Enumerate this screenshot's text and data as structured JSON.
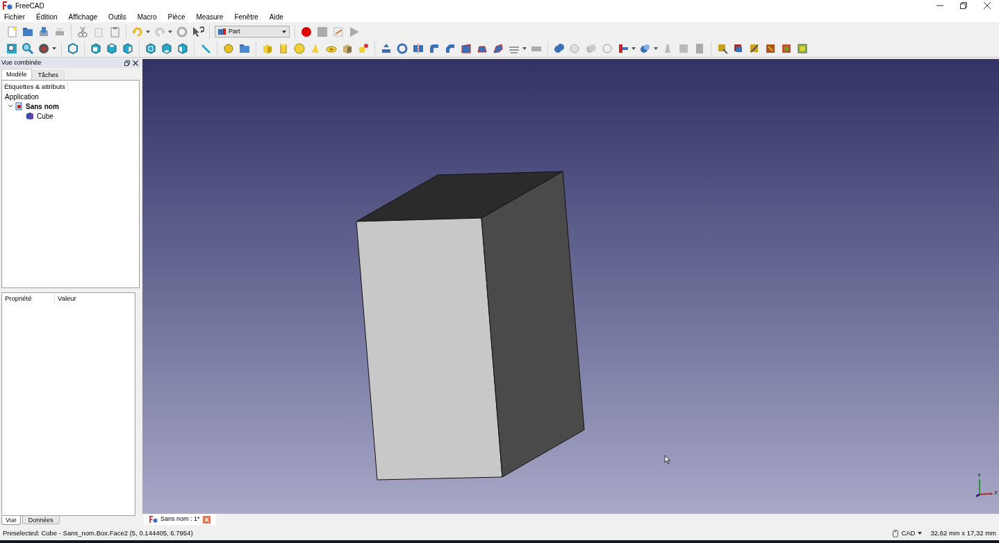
{
  "window": {
    "title": "FreeCAD"
  },
  "menu": [
    "Fichier",
    "Édition",
    "Affichage",
    "Outils",
    "Macro",
    "Pièce",
    "Measure",
    "Fenêtre",
    "Aide"
  ],
  "workbench": {
    "value": "Part"
  },
  "combo_view": {
    "title": "Vue combinée",
    "tabs": [
      {
        "label": "Modèle",
        "selected": true
      },
      {
        "label": "Tâches",
        "selected": false
      }
    ],
    "tree_header": "Étiquettes & attributs",
    "tree": [
      {
        "label": "Application",
        "children": [
          {
            "label": "Sans nom",
            "expanded": true,
            "children": [
              {
                "label": "Cube"
              }
            ]
          }
        ]
      }
    ],
    "property_columns": [
      "Propriété",
      "Valeur"
    ],
    "bottom_tabs": [
      {
        "label": "Vue",
        "selected": true
      },
      {
        "label": "Données",
        "selected": false
      }
    ]
  },
  "viewport": {
    "axis": {
      "y": "Y",
      "x": "X"
    }
  },
  "document_tab": {
    "label": "Sans nom : 1*"
  },
  "status_bar": {
    "message": "Preselected: Cube - Sans_nom.Box.Face2 (5, 0.144405, 6.7954)",
    "navigation": "CAD",
    "dimensions": "32,62 mm x 17,32 mm"
  }
}
